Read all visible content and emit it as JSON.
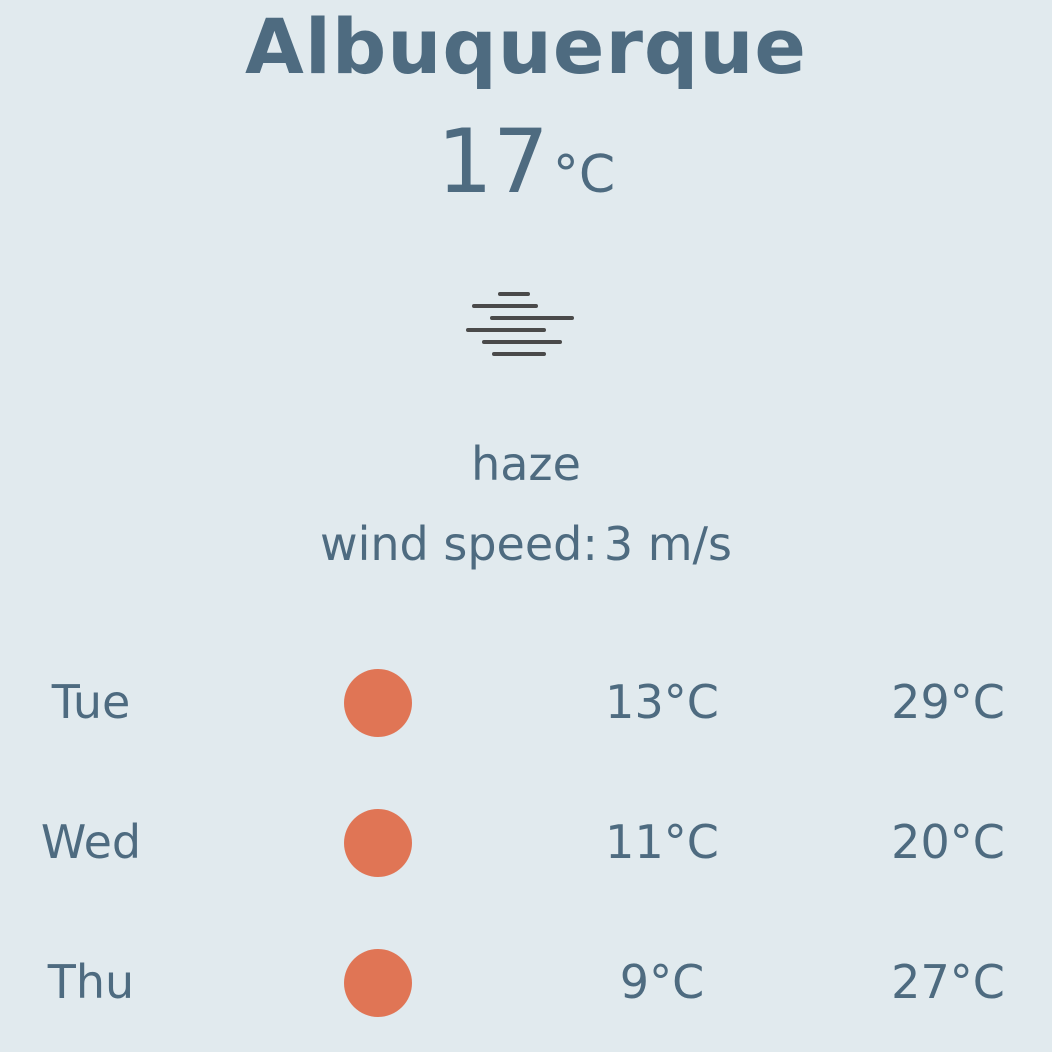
{
  "city": "Albuquerque",
  "current": {
    "temperature": "17",
    "unit": "°C",
    "condition_icon": "haze-icon",
    "description": "haze",
    "wind_label": "wind speed:",
    "wind_value": "3 m/s"
  },
  "colors": {
    "background": "#e1eaee",
    "text": "#4e6b80",
    "forecast_dot": "#e07555",
    "icon_lines": "#4a4a4a"
  },
  "forecast": [
    {
      "day": "Tue",
      "icon": "sun-dot-icon",
      "low": "13°C",
      "high": "29°C"
    },
    {
      "day": "Wed",
      "icon": "sun-dot-icon",
      "low": "11°C",
      "high": "20°C"
    },
    {
      "day": "Thu",
      "icon": "sun-dot-icon",
      "low": "9°C",
      "high": "27°C"
    }
  ]
}
